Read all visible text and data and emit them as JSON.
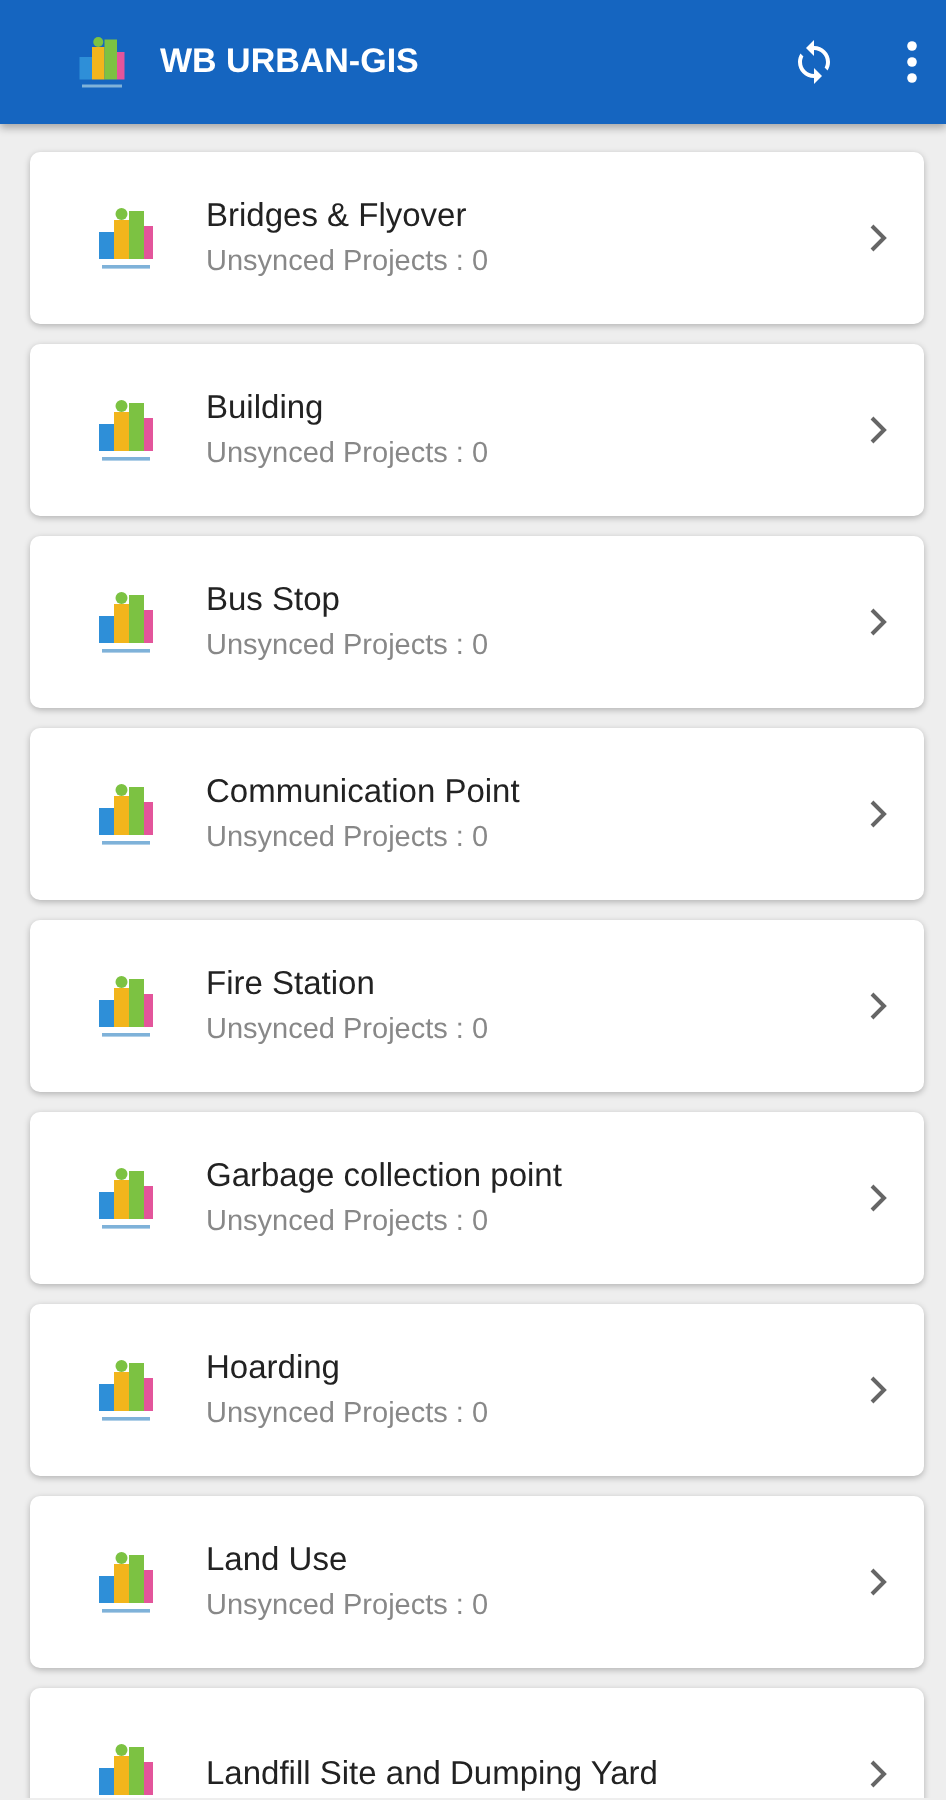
{
  "app_bar": {
    "title": "WB URBAN-GIS"
  },
  "items": [
    {
      "title": "Bridges & Flyover",
      "subtitle": "Unsynced Projects : 0"
    },
    {
      "title": "Building",
      "subtitle": "Unsynced Projects : 0"
    },
    {
      "title": "Bus Stop",
      "subtitle": "Unsynced Projects : 0"
    },
    {
      "title": "Communication Point",
      "subtitle": "Unsynced Projects : 0"
    },
    {
      "title": "Fire Station",
      "subtitle": "Unsynced Projects : 0"
    },
    {
      "title": "Garbage collection point",
      "subtitle": "Unsynced Projects : 0"
    },
    {
      "title": "Hoarding",
      "subtitle": "Unsynced Projects : 0"
    },
    {
      "title": "Land Use",
      "subtitle": "Unsynced Projects : 0"
    },
    {
      "title": "Landfill Site and Dumping Yard"
    }
  ]
}
